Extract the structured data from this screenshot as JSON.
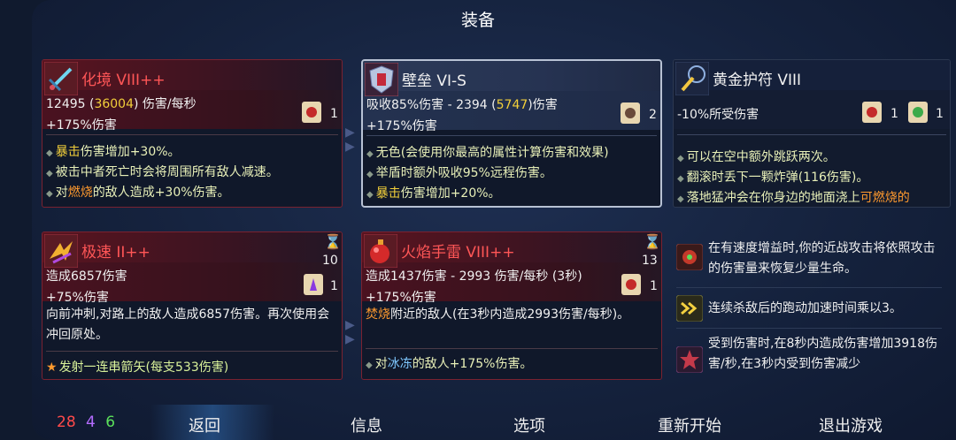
{
  "title": "装备",
  "cards": {
    "weapon": {
      "icon": "sword-icon",
      "name": "化境 VIII++",
      "stat_line1_a": "12495 (",
      "stat_line1_b": "36004",
      "stat_line1_c": ") 伤害/每秒",
      "stat_line2": "+175%伤害",
      "scroll_count": "1",
      "bullets": [
        {
          "pre": "",
          "hl": "暴击",
          "post": "伤害增加+30%。"
        },
        {
          "pre": "被击中者死亡时会将周围所有敌人减速。",
          "hl": "",
          "post": ""
        },
        {
          "pre": "对",
          "hl": "燃烧",
          "post": "的敌人造成+30%伤害。"
        }
      ]
    },
    "shield": {
      "icon": "shield-icon",
      "name": "壁垒 VI-S",
      "stat_line1_a": "吸收85%伤害 - 2394 (",
      "stat_line1_b": "5747",
      "stat_line1_c": ")伤害",
      "stat_line2": "+175%伤害",
      "scroll_count": "2",
      "bullets": [
        {
          "pre": "无色(会使用你最高的属性计算伤害和效果)",
          "hl": "",
          "post": ""
        },
        {
          "pre": "举盾时额外吸收95%远程伤害。",
          "hl": "",
          "post": ""
        },
        {
          "pre": "",
          "hl": "暴击",
          "post": "伤害增加+20%。"
        }
      ]
    },
    "amulet": {
      "icon": "amulet-icon",
      "name": "黄金护符 VIII",
      "stat_line1": "-10%所受伤害",
      "scroll_count_a": "1",
      "scroll_count_b": "1",
      "bullets": [
        {
          "pre": "可以在空中额外跳跃两次。",
          "hl": "",
          "post": ""
        },
        {
          "pre": "翻滚时丢下一颗炸弹(116伤害)。",
          "hl": "",
          "post": ""
        },
        {
          "pre": "落地猛冲会在你身边的地面浇上",
          "hl": "可燃烧的",
          "post": ""
        }
      ]
    },
    "skill1": {
      "icon": "dash-icon",
      "name": "极速 II++",
      "cooldown": "10",
      "stat_line1": "造成6857伤害",
      "stat_line2": "+75%伤害",
      "scroll_count": "1",
      "desc": "向前冲刺,对路上的敌人造成6857伤害。再次使用会冲回原处。",
      "extra": "发射一连串箭矢(每支533伤害)"
    },
    "skill2": {
      "icon": "grenade-icon",
      "name": "火焰手雷 VIII++",
      "cooldown": "13",
      "stat_line1": "造成1437伤害 - 2993 伤害/每秒 (3秒)",
      "stat_line2": "+175%伤害",
      "scroll_count": "1",
      "desc_hl": "焚烧",
      "desc": "附近的敌人(在3秒内造成2993伤害/每秒)。",
      "bullet_pre": "对",
      "bullet_hl": "冰冻",
      "bullet_post": "的敌人+175%伤害。"
    }
  },
  "mutations": [
    {
      "icon": "heal-mutation-icon",
      "text": "在有速度增益时,你的近战攻击将依照攻击的伤害量来恢复少量生命。"
    },
    {
      "icon": "speed-mutation-icon",
      "text": "连续杀敌后的跑动加速时间乘以3。"
    },
    {
      "icon": "damage-mutation-icon",
      "text": "受到伤害时,在8秒内造成伤害增加3918伤害/秒,在3秒内受到伤害减少"
    }
  ],
  "stats": {
    "brutality": "28",
    "tactics": "4",
    "survival": "6",
    "brutality_color": "#ff4a4a",
    "tactics_color": "#b46cff",
    "survival_color": "#5be05b"
  },
  "menu": {
    "back": "返回",
    "info": "信息",
    "options": "选项",
    "restart": "重新开始",
    "quit": "退出游戏"
  }
}
